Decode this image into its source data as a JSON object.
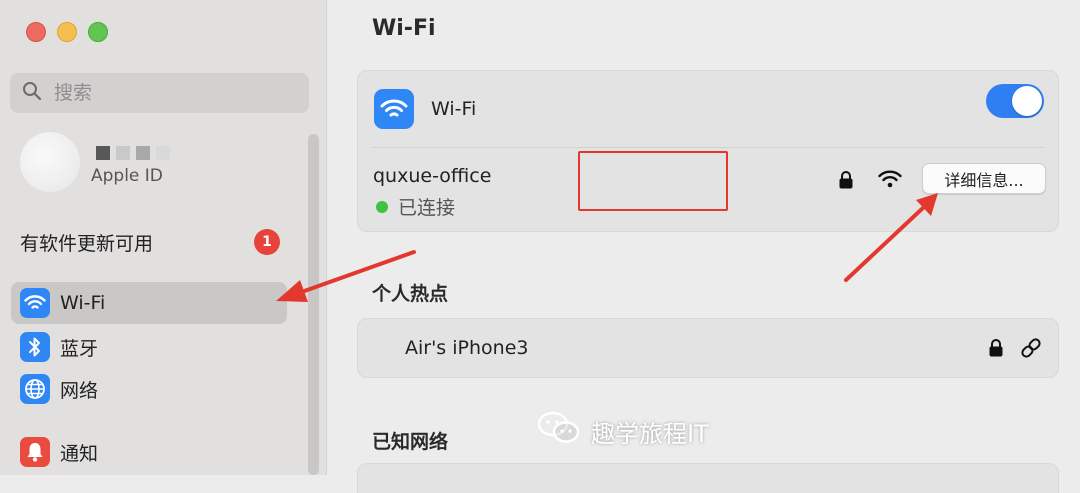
{
  "sidebar": {
    "search": {
      "placeholder": "搜索",
      "icon": "search-icon"
    },
    "account": {
      "apple_id_label": "Apple ID"
    },
    "update": {
      "label": "有软件更新可用",
      "badge_count": "1"
    },
    "items": [
      {
        "label": "Wi-Fi",
        "icon": "wifi-icon",
        "icon_color": "#2f86f5",
        "selected": true
      },
      {
        "label": "蓝牙",
        "icon": "bluetooth-icon",
        "icon_color": "#2f86f5",
        "selected": false
      },
      {
        "label": "网络",
        "icon": "globe-icon",
        "icon_color": "#2f86f5",
        "selected": false
      },
      {
        "label": "通知",
        "icon": "bell-icon",
        "icon_color": "#ea4b3f",
        "selected": false
      }
    ]
  },
  "main": {
    "title": "Wi-Fi",
    "wifi_card": {
      "label": "Wi-Fi",
      "toggle_on": true,
      "network": {
        "name": "quxue-office",
        "status": "已连接",
        "details_button": "详细信息..."
      }
    },
    "hotspot": {
      "section_title": "个人热点",
      "device_name": "Air's iPhone3"
    },
    "known_networks": {
      "section_title": "已知网络"
    }
  },
  "watermark": {
    "text": "趣学旅程IT"
  },
  "colors": {
    "accent_blue": "#2f7ff3",
    "annotation_red": "#e3382e",
    "connected_green": "#3fc240",
    "badge_red": "#e8433a"
  }
}
